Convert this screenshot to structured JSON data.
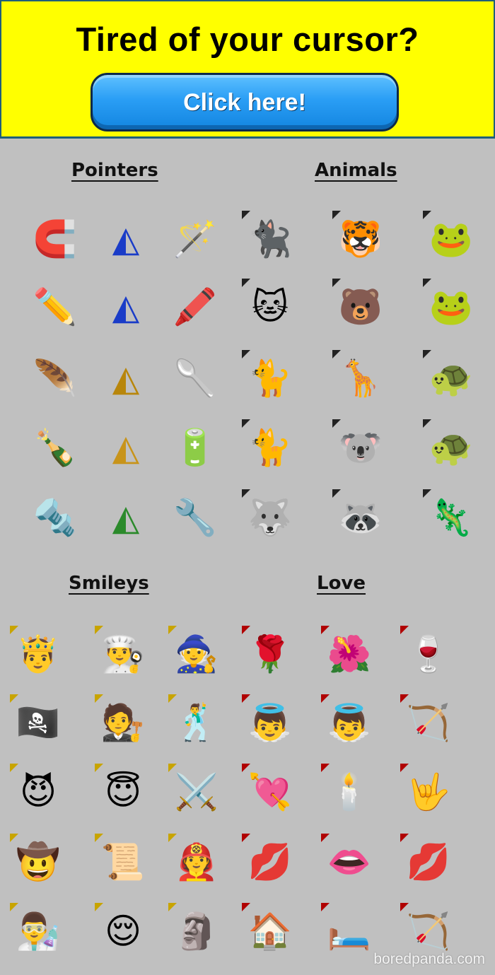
{
  "banner": {
    "title": "Tired of your cursor?",
    "button_label": "Click here!"
  },
  "sections": {
    "pointers": "Pointers",
    "animals": "Animals",
    "smileys": "Smileys",
    "love": "Love"
  },
  "watermark": "boredpanda.com",
  "icons": {
    "pointers": [
      [
        "horseshoe-magnet-icon",
        "blue-triangle-pointer-icon",
        "magic-wand-icon"
      ],
      [
        "pencil-icon",
        "blue-arrow-pointer-icon",
        "red-pencil-icon"
      ],
      [
        "feather-icon",
        "wood-triangle-pointer-icon",
        "spoon-icon"
      ],
      [
        "glass-bottle-icon",
        "leopard-triangle-pointer-icon",
        "battery-icon"
      ],
      [
        "hex-nut-icon",
        "striped-triangle-pointer-icon",
        "wrench-icon"
      ]
    ],
    "animals": [
      [
        "black-cat-icon",
        "tiger-icon",
        "frog-icon"
      ],
      [
        "orange-cat-icon",
        "bear-icon",
        "green-frog-icon"
      ],
      [
        "white-cat-icon",
        "giraffe-icon",
        "turtle-icon"
      ],
      [
        "gray-cat-icon",
        "koala-icon",
        "turtle-smiling-icon"
      ],
      [
        "husky-icon",
        "raccoon-icon",
        "lizard-icon"
      ]
    ],
    "smileys": [
      [
        "king-smiley-icon",
        "chef-smiley-icon",
        "wizard-smiley-icon"
      ],
      [
        "pirate-smiley-icon",
        "bishop-smiley-icon",
        "elvis-smiley-icon"
      ],
      [
        "devil-smiley-icon",
        "angel-smiley-icon",
        "knight-smiley-icon"
      ],
      [
        "cowboy-smiley-icon",
        "wanted-poster-icon",
        "firefighter-smiley-icon"
      ],
      [
        "einstein-smiley-icon",
        "sleepy-smiley-icon",
        "pharaoh-smiley-icon"
      ]
    ],
    "love": [
      [
        "rose-icon",
        "flower-icon",
        "wine-heart-icon"
      ],
      [
        "cupid-icon",
        "cupid-angel-icon",
        "bow-arrow-icon"
      ],
      [
        "heart-arrow-icon",
        "heart-candle-icon",
        "love-hand-icon"
      ],
      [
        "small-lips-icon",
        "big-lips-icon",
        "red-lips-icon"
      ],
      [
        "heart-house-icon",
        "love-bed-icon",
        "cupid-figure-icon"
      ]
    ]
  },
  "glyphs": {
    "pointers": [
      [
        "🧲",
        "◭",
        "🪄"
      ],
      [
        "✏️",
        "◭",
        "🖍️"
      ],
      [
        "🪶",
        "◭",
        "🥄"
      ],
      [
        "🍾",
        "◭",
        "🔋"
      ],
      [
        "🔩",
        "◭",
        "🔧"
      ]
    ],
    "animals": [
      [
        "🐈‍⬛",
        "🐯",
        "🐸"
      ],
      [
        "🐱",
        "🐻",
        "🐸"
      ],
      [
        "🐈",
        "🦒",
        "🐢"
      ],
      [
        "🐈",
        "🐨",
        "🐢"
      ],
      [
        "🐺",
        "🦝",
        "🦎"
      ]
    ],
    "smileys": [
      [
        "🤴",
        "👨‍🍳",
        "🧙"
      ],
      [
        "🏴‍☠️",
        "🧑‍⚖️",
        "🕺"
      ],
      [
        "😈",
        "😇",
        "⚔️"
      ],
      [
        "🤠",
        "📜",
        "🧑‍🚒"
      ],
      [
        "👨‍🔬",
        "😌",
        "🗿"
      ]
    ],
    "love": [
      [
        "🌹",
        "🌺",
        "🍷"
      ],
      [
        "👼",
        "👼",
        "🏹"
      ],
      [
        "💘",
        "🕯️",
        "🤟"
      ],
      [
        "💋",
        "👄",
        "💋"
      ],
      [
        "🏠",
        "🛏️",
        "🏹"
      ]
    ]
  },
  "glyph_colors": {
    "pointers": [
      [
        "#c00",
        "#1a3cc8",
        "#222"
      ],
      [
        "#e0a000",
        "#1a3cc8",
        "#c00"
      ],
      [
        "#eee",
        "#b8860b",
        "#aaa"
      ],
      [
        "#7fbf7f",
        "#c8941a",
        "#333"
      ],
      [
        "#bbb",
        "#2b8a2b",
        "#555"
      ]
    ]
  }
}
